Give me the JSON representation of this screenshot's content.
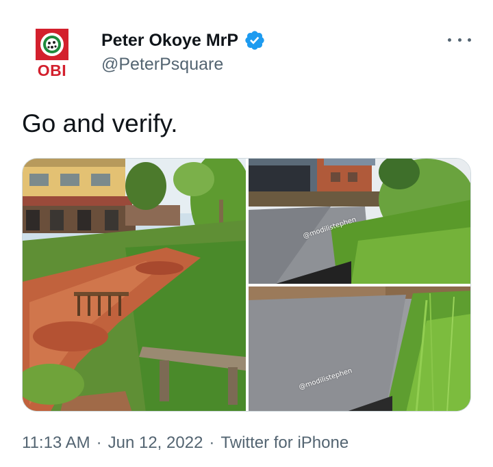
{
  "author": {
    "display_name": "Peter Okoye MrP",
    "handle": "@PeterPsquare",
    "avatar_text": "OBI",
    "verified": true,
    "avatar_colors": {
      "red": "#d3202d",
      "green": "#1e8a3c"
    }
  },
  "menu": {
    "icon": "more-horizontal-icon"
  },
  "tweet": {
    "text": "Go and verify."
  },
  "media": {
    "photos": [
      {
        "description_icon": "photo-street-drainage",
        "watermark": ""
      },
      {
        "description_icon": "photo-road-grass-1",
        "watermark": "@modilistephen"
      },
      {
        "description_icon": "photo-road-grass-2",
        "watermark": "@modilistephen"
      }
    ]
  },
  "meta": {
    "time": "11:13 AM",
    "date": "Jun 12, 2022",
    "source": "Twitter for iPhone",
    "separator": "·"
  },
  "colors": {
    "text_primary": "#0f1419",
    "text_secondary": "#536471",
    "verified_blue": "#1d9bf0",
    "border": "#cfd9de"
  }
}
